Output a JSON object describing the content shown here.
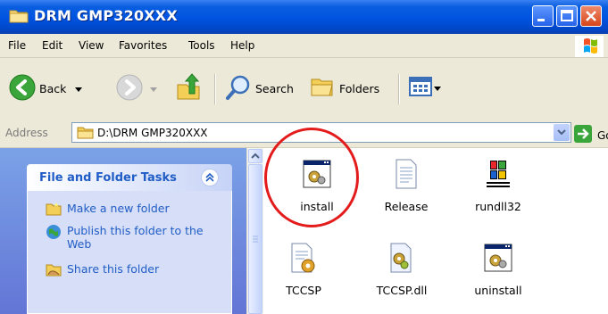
{
  "window": {
    "title": "DRM GMP320XXX"
  },
  "menu": [
    "File",
    "Edit",
    "View",
    "Favorites",
    "Tools",
    "Help"
  ],
  "toolbar": {
    "back_label": "Back",
    "search_label": "Search",
    "folders_label": "Folders"
  },
  "address": {
    "label": "Address",
    "value": "D:\\DRM GMP320XXX",
    "go_label": "Go"
  },
  "task_pane": {
    "title": "File and Folder Tasks",
    "links": [
      {
        "label": "Make a new folder",
        "icon": "new-folder-icon"
      },
      {
        "label": "Publish this folder to the Web",
        "icon": "publish-web-icon"
      },
      {
        "label": "Share this folder",
        "icon": "share-folder-icon"
      }
    ]
  },
  "files": [
    {
      "name": "install",
      "icon": "setup-program-icon"
    },
    {
      "name": "Release",
      "icon": "text-document-icon"
    },
    {
      "name": "rundll32",
      "icon": "windows-logo-icon"
    },
    {
      "name": "TCCSP",
      "icon": "config-document-icon"
    },
    {
      "name": "TCCSP.dll",
      "icon": "dll-file-icon"
    },
    {
      "name": "uninstall",
      "icon": "setup-program-icon"
    }
  ],
  "colors": {
    "title_bar": "#0053e0",
    "highlight_circle": "#e31b1b",
    "task_link": "#215dc6"
  }
}
